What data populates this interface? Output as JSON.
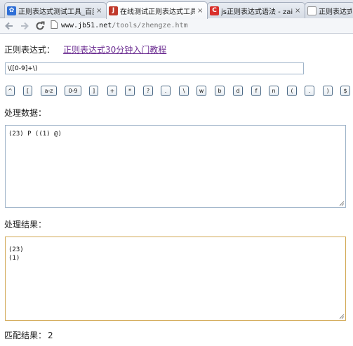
{
  "tabs": [
    {
      "title": "正则表达式测试工具_百度",
      "favicon": "baidu-paw-icon",
      "active": false
    },
    {
      "title": "在线测试正则表达式工具",
      "favicon": "jb51-logo-icon",
      "active": true
    },
    {
      "title": "js正则表达式语法 - zai",
      "favicon": "csdn-logo-icon",
      "active": false
    },
    {
      "title": "正则表达式",
      "favicon": "page-icon",
      "active": false
    }
  ],
  "toolbar": {
    "host": "www.jb51.net",
    "path": "/tools/zhengze.htm"
  },
  "page": {
    "regex_label": "正则表达式：",
    "tutorial_link": "正则表达式30分钟入门教程",
    "regex_value": "\\([0-9]+\\)",
    "buttons": [
      "^",
      "[",
      "a-z",
      "0-9",
      "]",
      "+",
      "*",
      "?",
      ".",
      "\\",
      "w",
      "b",
      "d",
      "f",
      "n",
      "(",
      ".",
      ")",
      "$"
    ],
    "data_label": "处理数据：",
    "data_value": "(23) P ((1) @)",
    "result_label": "处理结果：",
    "result_value": "(23)\n(1)",
    "match_label": "匹配结果：",
    "match_value": "2"
  },
  "colors": {
    "link": "#6b2c91",
    "input_border": "#9fb4c9",
    "result_border": "#d2a955"
  }
}
